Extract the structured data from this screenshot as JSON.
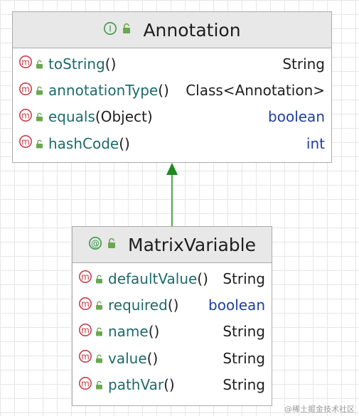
{
  "diagram": {
    "colors": {
      "method_icon": "#c8404c",
      "lock_icon": "#6aa84f",
      "interface_icon": "#3a9a4a",
      "arrow": "#1e8a1e",
      "member_name": "#1d6a6a",
      "primitive_type": "#1f3fa0"
    },
    "classes": [
      {
        "name": "Annotation",
        "kind_icon": "interface-icon",
        "kind_glyph": "I",
        "members": [
          {
            "name": "toString",
            "parens": "()",
            "type": "String",
            "primitive": false
          },
          {
            "name": "annotationType",
            "parens": "()",
            "type": "Class<Annotation>",
            "primitive": false
          },
          {
            "name": "equals",
            "parens": "(Object)",
            "type": "boolean",
            "primitive": true
          },
          {
            "name": "hashCode",
            "parens": "()",
            "type": "int",
            "primitive": true
          }
        ]
      },
      {
        "name": "MatrixVariable",
        "kind_icon": "annotation-icon",
        "kind_glyph": "@",
        "members": [
          {
            "name": "defaultValue",
            "parens": "()",
            "type": "String",
            "primitive": false
          },
          {
            "name": "required",
            "parens": "()",
            "type": "boolean",
            "primitive": true
          },
          {
            "name": "name",
            "parens": "()",
            "type": "String",
            "primitive": false
          },
          {
            "name": "value",
            "parens": "()",
            "type": "String",
            "primitive": false
          },
          {
            "name": "pathVar",
            "parens": "()",
            "type": "String",
            "primitive": false
          }
        ]
      }
    ],
    "relations": [
      {
        "from": "MatrixVariable",
        "to": "Annotation",
        "kind": "implements"
      }
    ]
  },
  "watermark": "@稀土掘金技术社区"
}
